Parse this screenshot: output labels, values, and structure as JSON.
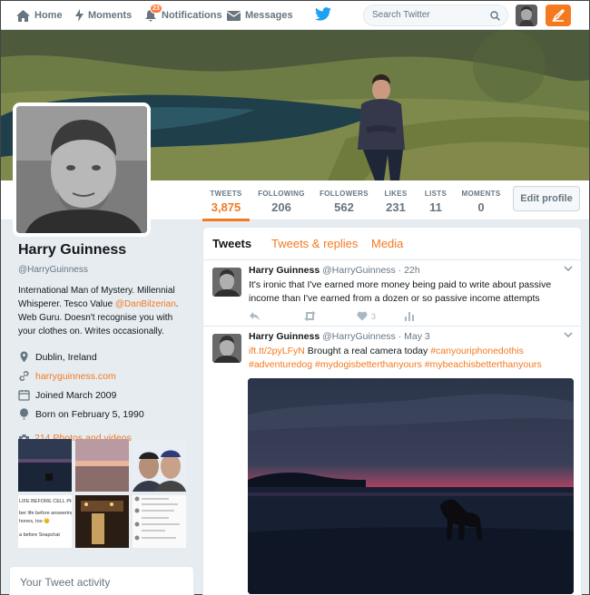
{
  "nav": {
    "home": "Home",
    "moments": "Moments",
    "notifications": "Notifications",
    "notifications_badge": "23",
    "messages": "Messages",
    "search_placeholder": "Search Twitter"
  },
  "stats": [
    {
      "label": "TWEETS",
      "value": "3,875"
    },
    {
      "label": "FOLLOWING",
      "value": "206"
    },
    {
      "label": "FOLLOWERS",
      "value": "562"
    },
    {
      "label": "LIKES",
      "value": "231"
    },
    {
      "label": "LISTS",
      "value": "11"
    },
    {
      "label": "MOMENTS",
      "value": "0"
    }
  ],
  "edit_profile": "Edit profile",
  "profile": {
    "name": "Harry Guinness",
    "handle": "@HarryGuinness",
    "bio_1": "International Man of Mystery. Millennial Whisperer. Tesco Value ",
    "bio_mention": "@DanBilzerian",
    "bio_2": ". Web Guru. Doesn't recognise you with your clothes on. Writes occasionally.",
    "location": "Dublin, Ireland",
    "website": "harryguinness.com",
    "joined": "Joined March 2009",
    "born": "Born on February 5, 1990",
    "photos": "214 Photos and videos"
  },
  "thumbs": {
    "t4_line1": "LIFE BEFORE CELL PHONE",
    "t4_line2": "ber life before answering m",
    "t4_line3": "hones, too 😊",
    "t4_line4": "a before Snapchat"
  },
  "activity": "Your Tweet activity",
  "tabs": {
    "tweets": "Tweets",
    "replies": "Tweets & replies",
    "media": "Media"
  },
  "tweets": [
    {
      "name": "Harry Guinness",
      "meta": "@HarryGuinness · 22h",
      "text": "It's ironic that I've earned more money being paid to write about passive income than I've earned from a dozen or so passive income attempts",
      "likes": "3"
    },
    {
      "name": "Harry Guinness",
      "meta": "@HarryGuinness · May 3",
      "link": "ift.tt/2pyLFyN",
      "text": " Brought a real camera today ",
      "tags_1": "#canyouriphonedothis",
      "tags_2": "#adventuredog #mydogisbetterthanyours #mybeachisbetterthanyours"
    }
  ],
  "colors": {
    "accent": "#f5791f",
    "twitter_blue": "#1da1f2"
  }
}
